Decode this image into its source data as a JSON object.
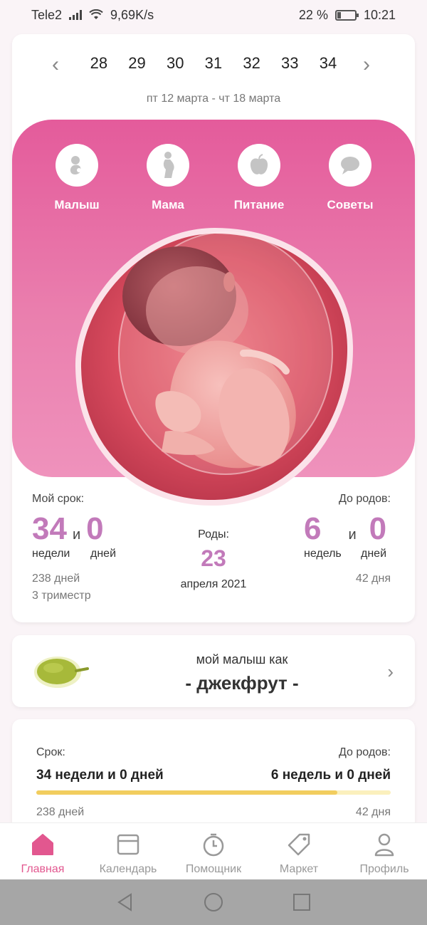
{
  "status": {
    "carrier": "Tele2",
    "speed": "9,69K/s",
    "battery": "22 %",
    "battery_level": 0.22,
    "time": "10:21"
  },
  "week_nav": {
    "weeks": [
      "28",
      "29",
      "30",
      "31",
      "32",
      "33",
      "34"
    ],
    "selected_week": "34",
    "date_range": "пт 12 марта - чт 18 марта"
  },
  "categories": [
    {
      "label": "Малыш",
      "icon": "baby-icon"
    },
    {
      "label": "Мама",
      "icon": "pregnant-woman-icon"
    },
    {
      "label": "Питание",
      "icon": "apple-icon"
    },
    {
      "label": "Советы",
      "icon": "chat-bubble-icon"
    }
  ],
  "term": {
    "label": "Мой срок:",
    "weeks": "34",
    "and": "и",
    "days": "0",
    "weeks_label": "недели",
    "days_label": "дней",
    "total_days": "238 дней",
    "trimester": "3 триместр"
  },
  "birth": {
    "label": "Роды:",
    "day": "23",
    "month_year": "апреля 2021"
  },
  "until_birth": {
    "label": "До родов:",
    "weeks": "6",
    "and": "и",
    "days": "0",
    "weeks_label": "недель",
    "days_label": "дней",
    "total_days": "42 дня"
  },
  "fruit": {
    "line1": "мой малыш как",
    "line2": "- джекфрут -"
  },
  "progress": {
    "term_label": "Срок:",
    "until_label": "До родов:",
    "term_value": "34 недели и 0 дней",
    "until_value": "6 недель и 0 дней",
    "days_passed": "238 дней",
    "days_left": "42 дня",
    "fraction": 0.85
  },
  "tabs": [
    {
      "label": "Главная",
      "icon": "home-icon",
      "active": true
    },
    {
      "label": "Календарь",
      "icon": "calendar-icon",
      "active": false
    },
    {
      "label": "Помощник",
      "icon": "timer-icon",
      "active": false
    },
    {
      "label": "Маркет",
      "icon": "tag-icon",
      "active": false
    },
    {
      "label": "Профиль",
      "icon": "user-icon",
      "active": false
    }
  ],
  "colors": {
    "accent_pink": "#e45b9b",
    "number_purple": "#c27aba",
    "progress_yellow": "#f2cd5e",
    "active_tab": "#e2578f"
  }
}
